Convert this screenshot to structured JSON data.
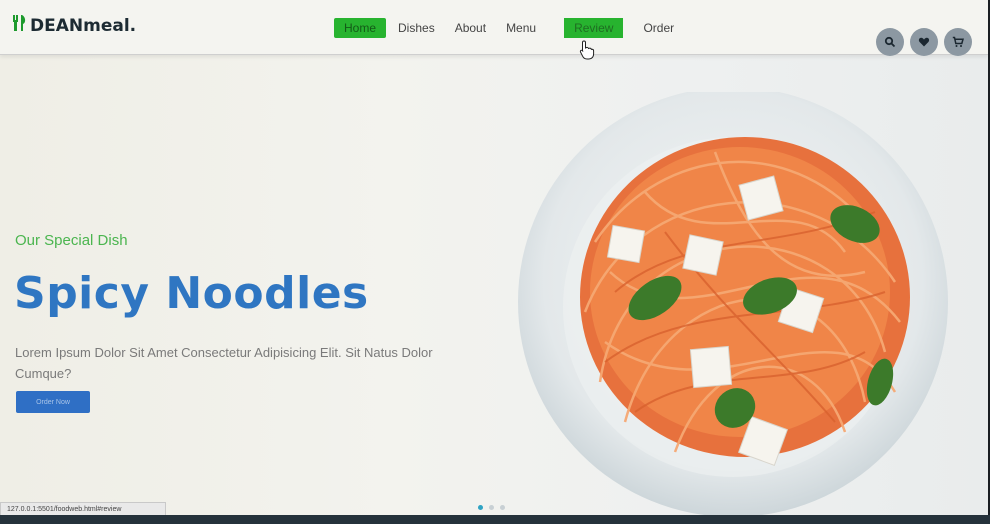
{
  "brand": {
    "name_main": "DEANmeal",
    "name_dot": "."
  },
  "nav": {
    "items": [
      {
        "label": "Home",
        "active": true
      },
      {
        "label": "Dishes",
        "active": false
      },
      {
        "label": "About",
        "active": false
      },
      {
        "label": "Menu",
        "active": false
      },
      {
        "label": "Review",
        "active": false,
        "hovered": true
      },
      {
        "label": "Order",
        "active": false
      }
    ]
  },
  "header_icons": [
    "search-icon",
    "heart-icon",
    "cart-icon"
  ],
  "hero": {
    "subtitle": "Our Special Dish",
    "title": "Spicy Noodles",
    "description": "Lorem Ipsum Dolor Sit Amet Consectetur Adipisicing Elit. Sit Natus Dolor Cumque?",
    "cta_label": "Order Now"
  },
  "slider": {
    "count": 3,
    "active_index": 0
  },
  "status_bar": {
    "url": "127.0.0.1:5501/foodweb.html#review"
  },
  "colors": {
    "accent_green": "#27b32f",
    "title_blue": "#2f76c2",
    "icon_bg": "#8c98a2"
  }
}
